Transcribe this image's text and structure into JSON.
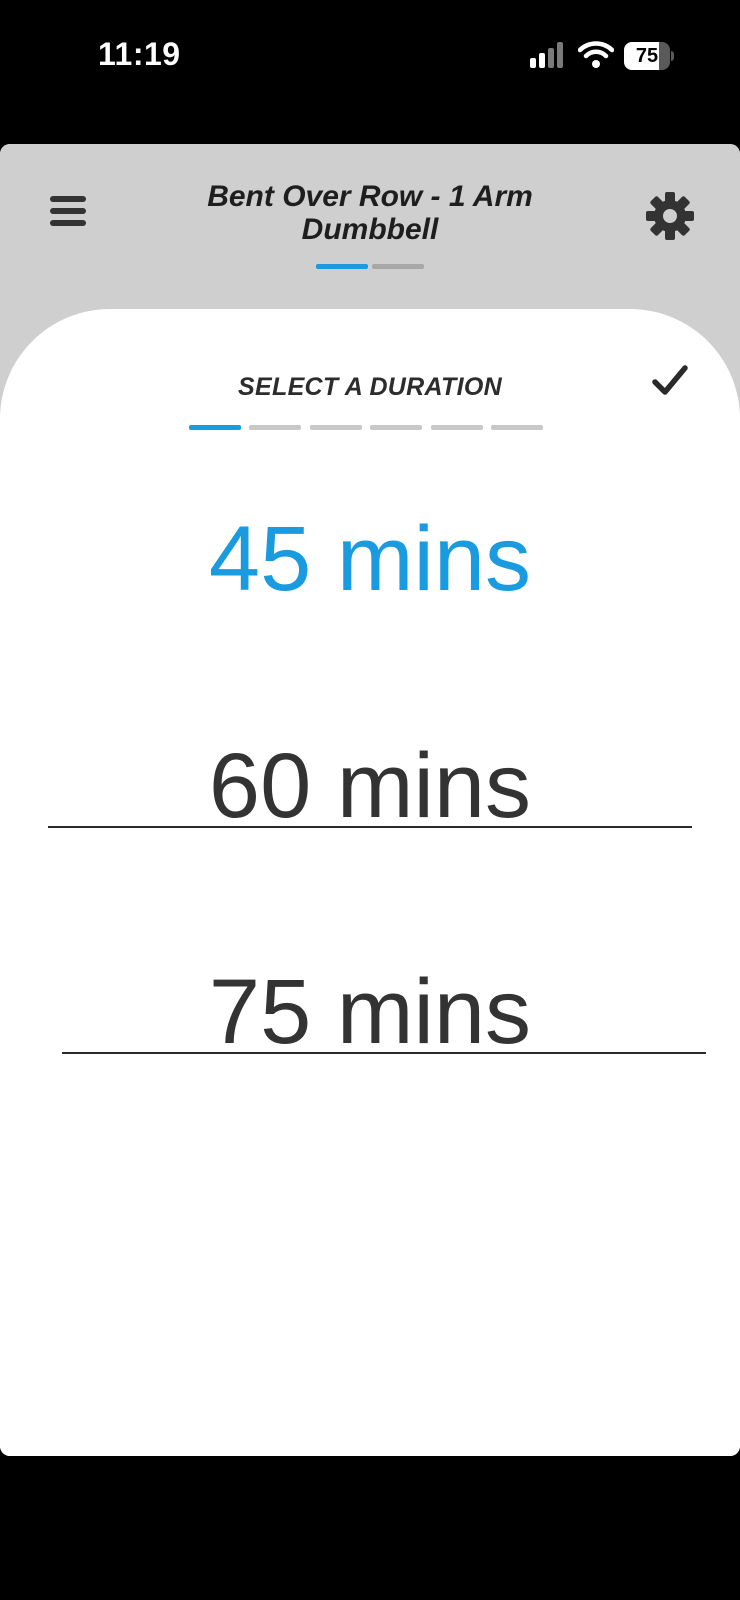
{
  "status_bar": {
    "time": "11:19",
    "battery_level": "75",
    "battery_fraction": 0.75
  },
  "header": {
    "title": "Bent Over Row - 1 Arm Dumbbell",
    "menu_icon": "hamburger-menu-icon",
    "settings_icon": "gear-icon",
    "page_indicators": {
      "count": 2,
      "active_index": 0
    }
  },
  "picker": {
    "title": "SELECT A DURATION",
    "confirm_icon": "checkmark-icon",
    "steps": {
      "count": 6,
      "active_index": 0
    },
    "options": [
      {
        "label": "45 mins",
        "selected": true
      },
      {
        "label": "60 mins",
        "selected": false
      },
      {
        "label": "75 mins",
        "selected": false
      }
    ]
  },
  "colors": {
    "accent": "#1a9be0",
    "header_bg": "#cfcfcf",
    "inactive_indicator": "#c8c8c8",
    "text_dark": "#333333"
  }
}
